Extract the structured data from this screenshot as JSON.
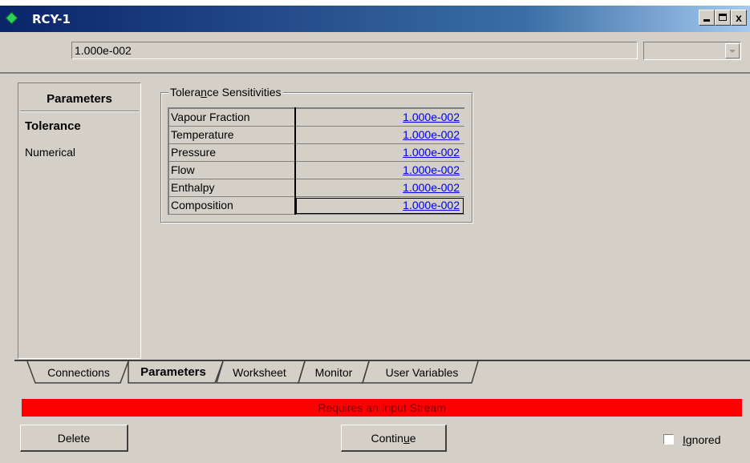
{
  "window": {
    "title": "RCY-1",
    "close_glyph": "x"
  },
  "value_bar": {
    "value": "1.000e-002",
    "unit": ""
  },
  "nav": {
    "header": "Parameters",
    "items": [
      {
        "label": "Tolerance",
        "selected": true
      },
      {
        "label": "Numerical",
        "selected": false
      }
    ]
  },
  "tolerance_group": {
    "title_pre": "Tolera",
    "title_underlined": "n",
    "title_post": "ce Sensitivities",
    "rows": [
      {
        "label": "Vapour Fraction",
        "value": "1.000e-002"
      },
      {
        "label": "Temperature",
        "value": "1.000e-002"
      },
      {
        "label": "Pressure",
        "value": "1.000e-002"
      },
      {
        "label": "Flow",
        "value": "1.000e-002"
      },
      {
        "label": "Enthalpy",
        "value": "1.000e-002"
      },
      {
        "label": "Composition",
        "value": "1.000e-002"
      }
    ]
  },
  "tabs": [
    {
      "label": "Connections",
      "active": false
    },
    {
      "label": "Parameters",
      "active": true
    },
    {
      "label": "Worksheet",
      "active": false
    },
    {
      "label": "Monitor",
      "active": false
    },
    {
      "label": "User Variables",
      "active": false
    }
  ],
  "status": {
    "text": "Requires an Input Stream",
    "color": "#ff0000"
  },
  "buttons": {
    "delete": "Delete",
    "continue_pre": "Contin",
    "continue_underlined": "u",
    "continue_post": "e"
  },
  "ignored": {
    "checked": false,
    "label_underlined": "I",
    "label_rest": "gnored"
  },
  "colors": {
    "title_bar": "#0a246a",
    "link_value": "#0000e0",
    "face": "#d4d0c8"
  }
}
